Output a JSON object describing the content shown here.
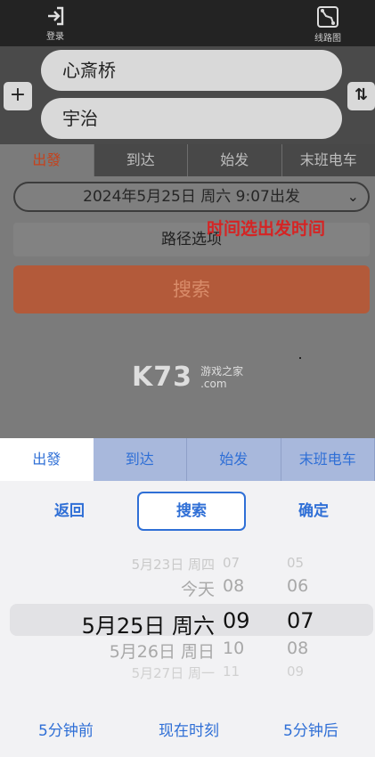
{
  "topbar": {
    "login_label": "登录",
    "map_label": "线路图"
  },
  "stations": {
    "from": "心斎桥",
    "to": "宇治",
    "add_symbol": "+",
    "swap_symbol": "⇅"
  },
  "tabs": [
    "出發",
    "到达",
    "始发",
    "末班电车"
  ],
  "form": {
    "datetime": "2024年5月25日 周六  9:07出发",
    "route_options": "路径选项",
    "search": "搜索",
    "overlay_note": "时间选出发时间"
  },
  "watermark": {
    "brand": "K73",
    "site": "游戏之家",
    "domain": ".com"
  },
  "sheet": {
    "tabs": [
      "出發",
      "到达",
      "始发",
      "末班电车"
    ],
    "back": "返回",
    "search": "搜索",
    "confirm": "确定",
    "picker": [
      {
        "date": "5月23日 周四",
        "hour": "07",
        "minute": "05"
      },
      {
        "date": "今天",
        "hour": "08",
        "minute": "06"
      },
      {
        "date": "5月25日 周六",
        "hour": "09",
        "minute": "07"
      },
      {
        "date": "5月26日 周日",
        "hour": "10",
        "minute": "08"
      },
      {
        "date": "5月27日 周一",
        "hour": "11",
        "minute": "09"
      }
    ],
    "quick": {
      "minus5": "5分钟前",
      "now": "现在时刻",
      "plus5": "5分钟后"
    }
  },
  "colors": {
    "accent_blue": "#2f6fd6",
    "active_tab_red": "#c5421c",
    "note_red": "#d52424"
  }
}
